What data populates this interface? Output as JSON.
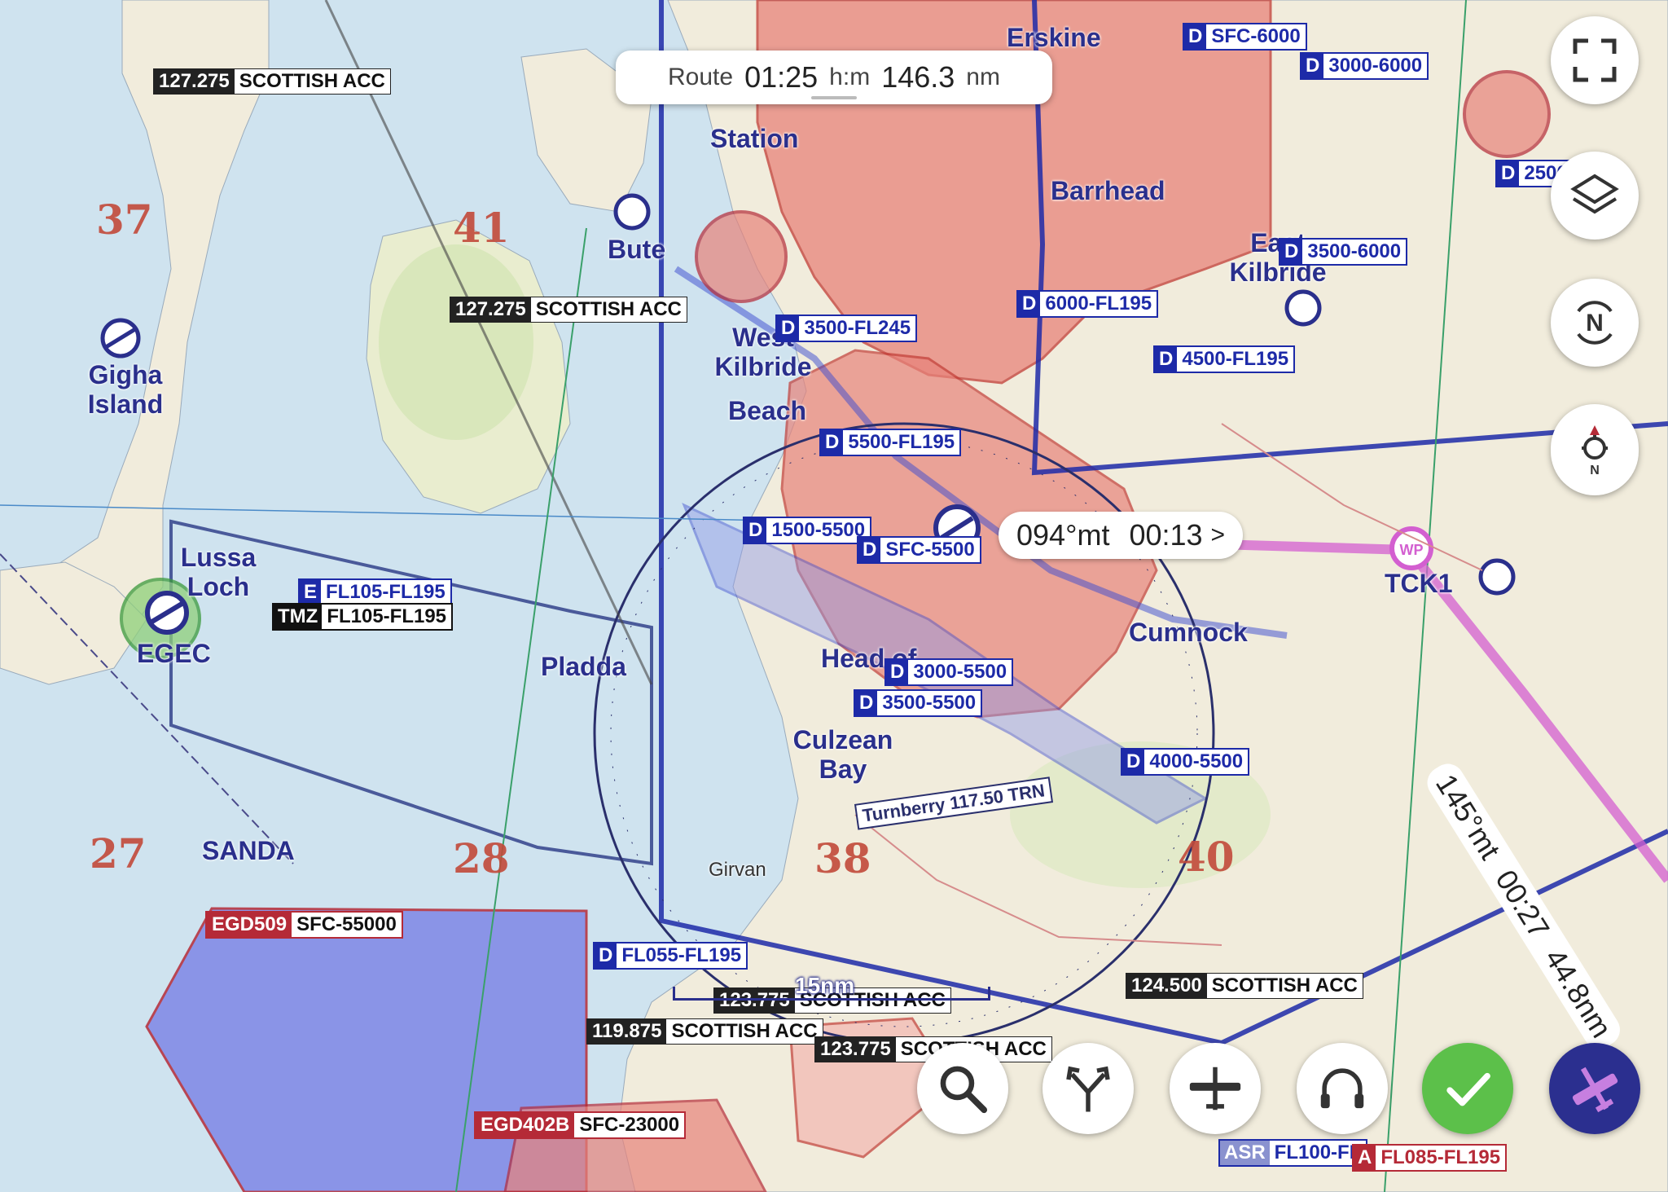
{
  "route_bar": {
    "label": "Route",
    "time": "01:25",
    "time_unit": "h:m",
    "distance": "146.3",
    "distance_unit": "nm"
  },
  "leg_bubble": {
    "heading": "094°mt",
    "time": "00:13",
    "chevron": ">"
  },
  "leg2": {
    "heading": "145°mt",
    "time": "00:27",
    "distance": "44.8nm"
  },
  "waypoint": {
    "name": "TCK1",
    "badge": "WP"
  },
  "scale": "15nm",
  "right_controls": [
    {
      "name": "fullscreen-button",
      "icon": "fullscreen-icon"
    },
    {
      "name": "layers-button",
      "icon": "layers-icon"
    },
    {
      "name": "north-up-button",
      "icon": "north-icon",
      "letter": "N"
    },
    {
      "name": "locate-button",
      "icon": "location-compass-icon",
      "letter": "N"
    }
  ],
  "bottom_toolbar": [
    {
      "name": "search-button",
      "icon": "search-icon"
    },
    {
      "name": "route-button",
      "icon": "route-split-icon"
    },
    {
      "name": "aircraft-button",
      "icon": "airplane-icon"
    },
    {
      "name": "audio-button",
      "icon": "headset-icon"
    },
    {
      "name": "confirm-button",
      "icon": "check-icon",
      "color": "#5cc04a"
    },
    {
      "name": "flight-mode-button",
      "icon": "plane-icon",
      "color": "#2b2f8f"
    }
  ],
  "airspace_labels": [
    {
      "cls": "D",
      "range": "SFC-6000"
    },
    {
      "cls": "D",
      "range": "3000-6000"
    },
    {
      "cls": "D",
      "range": "2500"
    },
    {
      "cls": "D",
      "range": "3500-6000"
    },
    {
      "cls": "D",
      "range": "6000-FL195"
    },
    {
      "cls": "D",
      "range": "3500-FL245"
    },
    {
      "cls": "D",
      "range": "4500-FL195"
    },
    {
      "cls": "D",
      "range": "5500-FL195"
    },
    {
      "cls": "D",
      "range": "1500-5500"
    },
    {
      "cls": "D",
      "range": "SFC-5500"
    },
    {
      "cls": "E",
      "range": "FL105-FL195"
    },
    {
      "cls": "TMZ",
      "range": "FL105-FL195"
    },
    {
      "cls": "D",
      "range": "3000-5500"
    },
    {
      "cls": "D",
      "range": "3500-5500"
    },
    {
      "cls": "D",
      "range": "4000-5500"
    },
    {
      "cls": "D",
      "range": "FL055-FL195"
    },
    {
      "cls": "ASR",
      "range": "FL100-FL"
    },
    {
      "cls": "A",
      "range": "FL085-FL195"
    }
  ],
  "frequency_labels": [
    {
      "freq": "127.275",
      "name": "SCOTTISH ACC"
    },
    {
      "freq": "127.275",
      "name": "SCOTTISH ACC"
    },
    {
      "freq": "124.500",
      "name": "SCOTTISH ACC"
    },
    {
      "freq": "123.775",
      "name": "SCOTTISH ACC"
    },
    {
      "freq": "119.875",
      "name": "SCOTTISH ACC"
    },
    {
      "freq": "123.775",
      "name": "SCOTTISH ACC"
    }
  ],
  "restricted_labels": [
    {
      "code": "EGD509",
      "range": "SFC-55000"
    },
    {
      "code": "EGD402B",
      "range": "SFC-23000"
    }
  ],
  "places": [
    "Erskine",
    "Barrhead",
    "East Kilbride",
    "Station",
    "Bute",
    "West Kilbride",
    "Beach",
    "Gigha Island",
    "Lussa Loch",
    "EGEC",
    "Pladda",
    "Cumnock",
    "Head of",
    "Culzean Bay",
    "SANDA",
    "Turnberry 117.50 TRN",
    "Girvan"
  ],
  "grid_numbers": [
    "37",
    "41",
    "27",
    "28",
    "38",
    "40"
  ]
}
